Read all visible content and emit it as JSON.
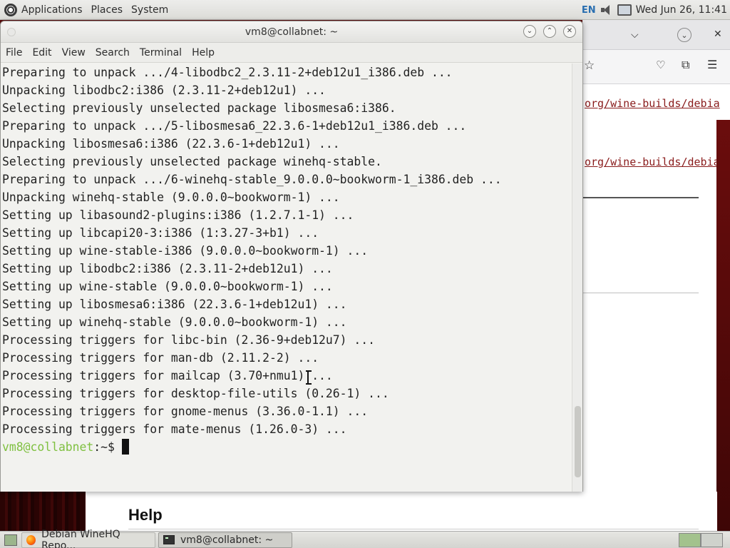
{
  "top_panel": {
    "menus": [
      "Applications",
      "Places",
      "System"
    ],
    "keyboard_layout": "EN",
    "clock": "Wed Jun 26, 11:41"
  },
  "browser": {
    "links": [
      "org/wine-builds/debia",
      "org/wine-builds/debia"
    ],
    "help_heading": "Help"
  },
  "terminal": {
    "title": "vm8@collabnet: ~",
    "menu": [
      "File",
      "Edit",
      "View",
      "Search",
      "Terminal",
      "Help"
    ],
    "lines": [
      "Preparing to unpack .../4-libodbc2_2.3.11-2+deb12u1_i386.deb ...",
      "Unpacking libodbc2:i386 (2.3.11-2+deb12u1) ...",
      "Selecting previously unselected package libosmesa6:i386.",
      "Preparing to unpack .../5-libosmesa6_22.3.6-1+deb12u1_i386.deb ...",
      "Unpacking libosmesa6:i386 (22.3.6-1+deb12u1) ...",
      "Selecting previously unselected package winehq-stable.",
      "Preparing to unpack .../6-winehq-stable_9.0.0.0~bookworm-1_i386.deb ...",
      "Unpacking winehq-stable (9.0.0.0~bookworm-1) ...",
      "Setting up libasound2-plugins:i386 (1.2.7.1-1) ...",
      "Setting up libcapi20-3:i386 (1:3.27-3+b1) ...",
      "Setting up wine-stable-i386 (9.0.0.0~bookworm-1) ...",
      "Setting up libodbc2:i386 (2.3.11-2+deb12u1) ...",
      "Setting up wine-stable (9.0.0.0~bookworm-1) ...",
      "Setting up libosmesa6:i386 (22.3.6-1+deb12u1) ...",
      "Setting up winehq-stable (9.0.0.0~bookworm-1) ...",
      "Processing triggers for libc-bin (2.36-9+deb12u7) ...",
      "Processing triggers for man-db (2.11.2-2) ...",
      "Processing triggers for mailcap (3.70+nmu1) ...",
      "Processing triggers for desktop-file-utils (0.26-1) ...",
      "Processing triggers for gnome-menus (3.36.0-1.1) ...",
      "Processing triggers for mate-menus (1.26.0-3) ..."
    ],
    "prompt_user": "vm8@collabnet",
    "prompt_path": ":~$"
  },
  "taskbar": {
    "tasks": [
      "Debian WineHQ Repo...",
      "vm8@collabnet: ~"
    ]
  },
  "colors": {
    "terminal_bg": "#f2f2ef",
    "prompt_green": "#7fc040",
    "link_red": "#8a1c1c",
    "desktop_red": "#5a0a0a"
  }
}
